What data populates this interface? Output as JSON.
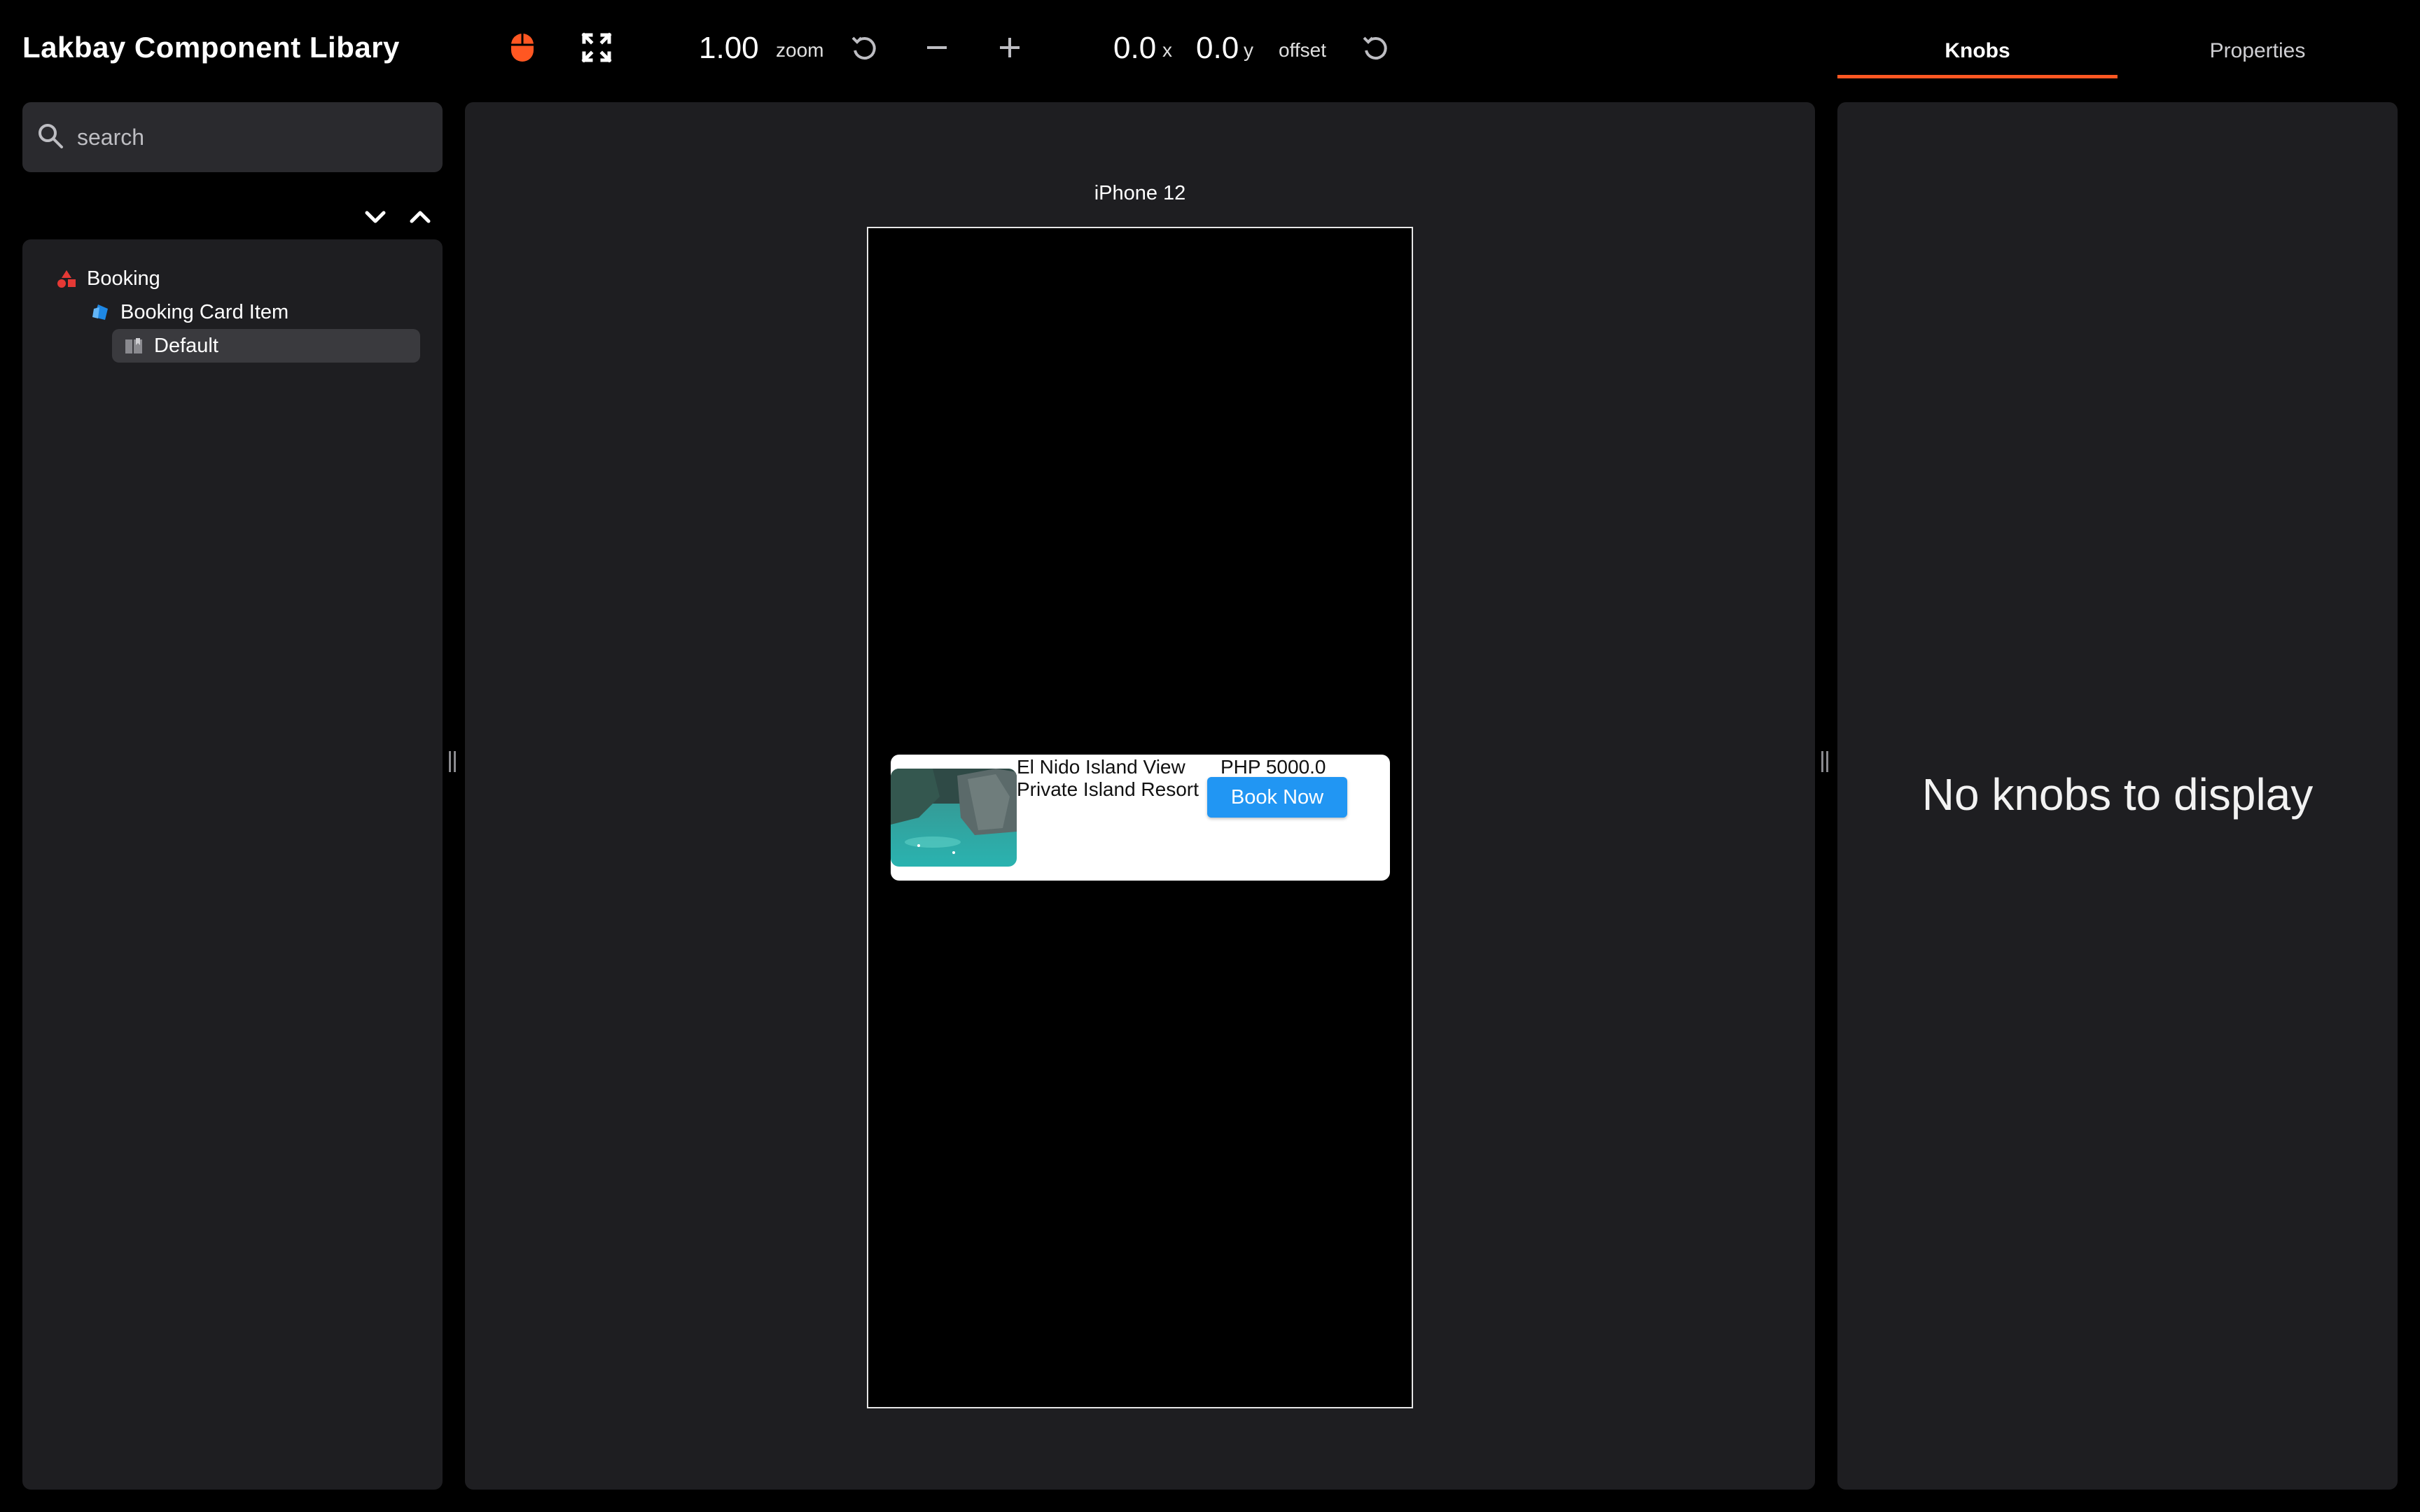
{
  "app": {
    "title": "Lakbay Component Libary"
  },
  "toolbar": {
    "zoom_value": "1.00",
    "zoom_label": "zoom",
    "offset_x_value": "0.0",
    "offset_x_label": "x",
    "offset_y_value": "0.0",
    "offset_y_label": "y",
    "offset_label": "offset",
    "icons": [
      "mouse-icon",
      "fullscreen-icon",
      "reset-zoom-icon",
      "zoom-out-icon",
      "zoom-in-icon",
      "reset-offset-icon"
    ],
    "accent_color": "#ff5722"
  },
  "tabs": [
    {
      "label": "Knobs",
      "active": true
    },
    {
      "label": "Properties",
      "active": false
    }
  ],
  "sidebar": {
    "search_placeholder": "search",
    "tree": [
      {
        "label": "Booking",
        "icon": "category-icon",
        "level": 0
      },
      {
        "label": "Booking Card Item",
        "icon": "component-icon",
        "level": 1
      },
      {
        "label": "Default",
        "icon": "use-case-icon",
        "level": 2,
        "selected": true
      }
    ]
  },
  "preview": {
    "device_name": "iPhone 12",
    "card": {
      "title": "El Nido Island View",
      "subtitle": "Private Island Resort",
      "price": "PHP 5000.0",
      "button_label": "Book Now",
      "button_color": "#2196f3"
    }
  },
  "knobs_panel": {
    "empty_message": "No knobs to display"
  }
}
